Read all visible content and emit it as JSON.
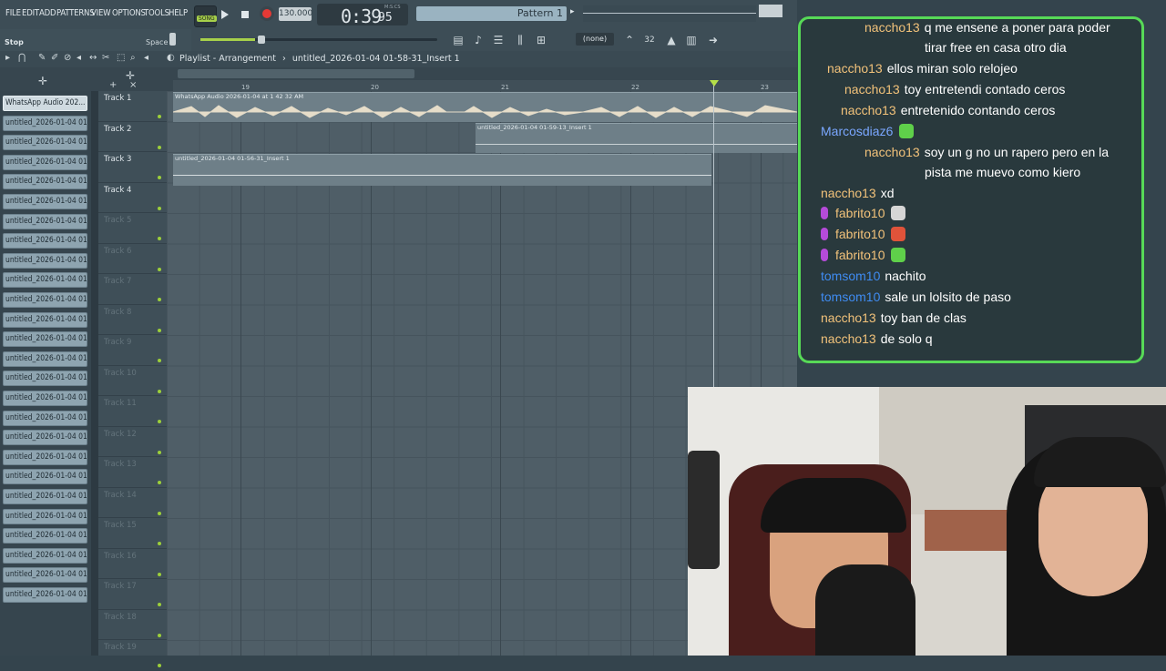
{
  "menu": {
    "items": [
      "FILE",
      "EDIT",
      "ADD",
      "PATTERNS",
      "VIEW",
      "OPTIONS",
      "TOOLS",
      "HELP"
    ]
  },
  "transport": {
    "song_badge": "SONG",
    "tempo": "130.000",
    "time": "0:39",
    "time_frac": "95",
    "time_unit": "M:S:CS",
    "pattern": "Pattern 1"
  },
  "hint": {
    "text": "Stop",
    "key": "Space"
  },
  "snap": "(none)",
  "playlist": {
    "title": "Playlist - Arrangement",
    "insert": "untitled_2026-01-04 01-58-31_Insert 1",
    "ruler": [
      "19",
      "20",
      "21",
      "22",
      "23"
    ]
  },
  "clips": [
    "WhatsApp Audio 202...",
    "untitled_2026-01-04 01-...",
    "untitled_2026-01-04 01-...",
    "untitled_2026-01-04 01-...",
    "untitled_2026-01-04 01-...",
    "untitled_2026-01-04 01-...",
    "untitled_2026-01-04 01-...",
    "untitled_2026-01-04 01-...",
    "untitled_2026-01-04 01-...",
    "untitled_2026-01-04 01-...",
    "untitled_2026-01-04 01-...",
    "untitled_2026-01-04 01-...",
    "untitled_2026-01-04 01-...",
    "untitled_2026-01-04 01-...",
    "untitled_2026-01-04 01-...",
    "untitled_2026-01-04 01-...",
    "untitled_2026-01-04 01-...",
    "untitled_2026-01-04 01-...",
    "untitled_2026-01-04 01-...",
    "untitled_2026-01-04 01-...",
    "untitled_2026-01-04 01-...",
    "untitled_2026-01-04 01-...",
    "untitled_2026-01-04 01-...",
    "untitled_2026-01-04 01-...",
    "untitled_2026-01-04 01-...",
    "untitled_2026-01-04 01-..."
  ],
  "tracks": [
    "Track 1",
    "Track 2",
    "Track 3",
    "Track 4",
    "Track 5",
    "Track 6",
    "Track 7",
    "Track 8",
    "Track 9",
    "Track 10",
    "Track 11",
    "Track 12",
    "Track 13",
    "Track 14",
    "Track 15",
    "Track 16",
    "Track 17",
    "Track 18",
    "Track 19"
  ],
  "arrangement": {
    "track1_clip": "WhatsApp Audio 2026-01-04 at 1 42 32 AM",
    "track2_clip": "untitled_2026-01-04 01-59-13_Insert 1",
    "track3_clip": "untitled_2026-01-04 01-56-31_Insert 1"
  },
  "chat": [
    {
      "user": "naccho13",
      "text": "q me ensene a poner para poder",
      "color": "#f2c27a"
    },
    {
      "user": "",
      "text": "tirar free en casa otro dia",
      "color": "#f2c27a"
    },
    {
      "user": "naccho13",
      "text": "ellos miran solo relojeo",
      "color": "#f2c27a"
    },
    {
      "user": "naccho13",
      "text": "toy entretendi contado ceros",
      "color": "#f2c27a"
    },
    {
      "user": "naccho13",
      "text": "entretenido contando ceros",
      "color": "#f2c27a"
    },
    {
      "user": "Marcosdiaz6",
      "text": "",
      "color": "#7aa7ff",
      "emote": "#5fd04a"
    },
    {
      "user": "naccho13",
      "text": "soy un g no un rapero pero en la",
      "color": "#f2c27a"
    },
    {
      "user": "",
      "text": "pista me muevo como kiero",
      "color": "#f2c27a"
    },
    {
      "user": "naccho13",
      "text": "xd",
      "color": "#f2c27a"
    },
    {
      "user": "fabrito10",
      "text": "",
      "color": "#f2c27a",
      "emote": "#d6d6d6",
      "mic": true
    },
    {
      "user": "fabrito10",
      "text": "",
      "color": "#f2c27a",
      "emote": "#e0533a",
      "mic": true
    },
    {
      "user": "fabrito10",
      "text": "",
      "color": "#f2c27a",
      "emote": "#5fd04a",
      "mic": true
    },
    {
      "user": "tomsom10",
      "text": "nachito",
      "color": "#3f8cf2"
    },
    {
      "user": "tomsom10",
      "text": "sale un lolsito de paso",
      "color": "#3f8cf2"
    },
    {
      "user": "naccho13",
      "text": "toy ban de clas",
      "color": "#f2c27a"
    },
    {
      "user": "naccho13",
      "text": "de solo q",
      "color": "#f2c27a"
    }
  ],
  "colors": {
    "chat_border": "#57d957",
    "accent_green": "#a6d04a",
    "record_red": "#e53935"
  }
}
